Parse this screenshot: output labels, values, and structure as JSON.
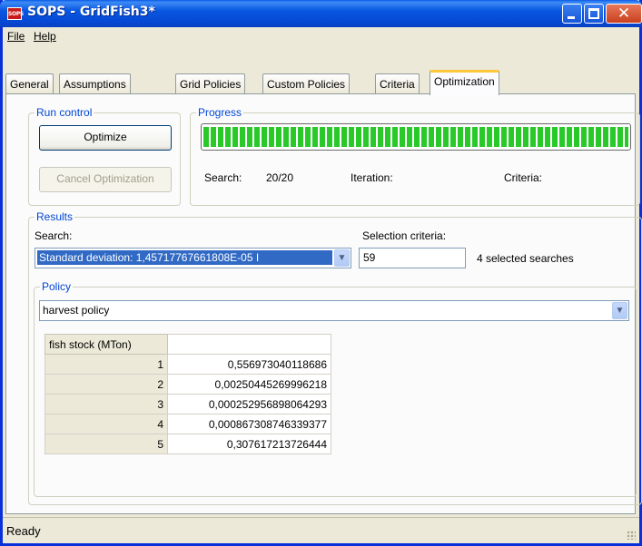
{
  "window": {
    "icon_label": "SOPS",
    "title": "SOPS - GridFish3*",
    "min_label": "minimize",
    "max_label": "maximize",
    "close_glyph": "✕"
  },
  "menu": {
    "file": "File",
    "help": "Help"
  },
  "tabs": [
    {
      "label": "General"
    },
    {
      "label": "Assumptions"
    },
    {
      "label": "Grid Policies"
    },
    {
      "label": "Custom Policies"
    },
    {
      "label": "Criteria"
    },
    {
      "label": "Optimization",
      "active": true
    }
  ],
  "run_control": {
    "group_label": "Run control",
    "optimize_label": "Optimize",
    "cancel_label": "Cancel Optimization"
  },
  "progress": {
    "group_label": "Progress",
    "percent": 100,
    "search_label": "Search:",
    "search_value": "20/20",
    "iteration_label": "Iteration:",
    "criteria_label": "Criteria:"
  },
  "results": {
    "group_label": "Results",
    "search_label": "Search:",
    "search_value": "Standard deviation: 1,45717767661808E-05 I",
    "selection_label": "Selection criteria:",
    "selection_value": "59",
    "selected_text": "4 selected searches"
  },
  "policy": {
    "group_label": "Policy",
    "value": "harvest policy",
    "table": {
      "column_header": "fish stock (MTon)",
      "rows": [
        {
          "index": "1",
          "value": "0,556973040118686"
        },
        {
          "index": "2",
          "value": "0,00250445269996218"
        },
        {
          "index": "3",
          "value": "0,000252956898064293"
        },
        {
          "index": "4",
          "value": "0,000867308746339377"
        },
        {
          "index": "5",
          "value": "0,307617213726444"
        }
      ]
    }
  },
  "status": {
    "text": "Ready"
  }
}
